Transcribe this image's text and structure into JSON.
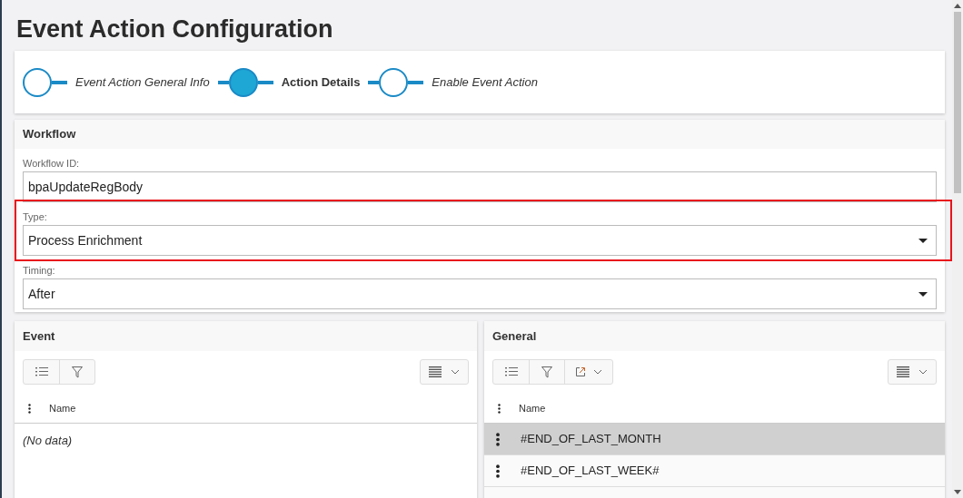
{
  "title": "Event Action Configuration",
  "steps": [
    {
      "label": "Event Action General Info",
      "selected": false
    },
    {
      "label": "Action Details",
      "selected": true
    },
    {
      "label": "Enable Event Action",
      "selected": false
    }
  ],
  "workflow": {
    "title": "Workflow",
    "fields": [
      {
        "label": "Workflow ID:",
        "value": "bpaUpdateRegBody",
        "kind": "text",
        "highlighted": false
      },
      {
        "label": "Type:",
        "value": "Process Enrichment",
        "kind": "select",
        "highlighted": true
      },
      {
        "label": "Timing:",
        "value": "After",
        "kind": "select",
        "highlighted": false
      }
    ]
  },
  "panels": [
    {
      "title": "Event",
      "tools": [
        {
          "kind": "list"
        },
        {
          "kind": "filter"
        }
      ],
      "columns": [
        "Name"
      ],
      "empty_text": "(No data)"
    },
    {
      "title": "General",
      "tools": [
        {
          "kind": "list"
        },
        {
          "kind": "filter"
        },
        {
          "kind": "export"
        }
      ],
      "columns": [
        "Name"
      ],
      "rows": [
        {
          "name": "#END_OF_LAST_MONTH",
          "selected": true
        },
        {
          "name": "#END_OF_LAST_WEEK#",
          "selected": false
        }
      ]
    }
  ]
}
